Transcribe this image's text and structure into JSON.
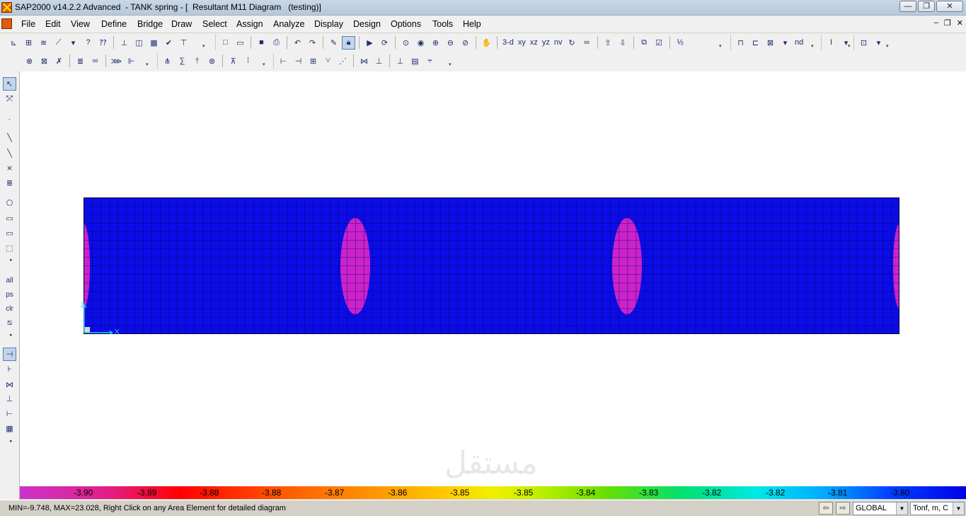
{
  "window": {
    "title": "SAP2000 v14.2.2 Advanced  - TANK spring - [  Resultant M11 Diagram   (testing)]",
    "minimize": "—",
    "maximize": "❐",
    "close": "✕"
  },
  "menu": {
    "items": [
      "File",
      "Edit",
      "View",
      "Define",
      "Bridge",
      "Draw",
      "Select",
      "Assign",
      "Analyze",
      "Display",
      "Design",
      "Options",
      "Tools",
      "Help"
    ],
    "mdi_minimize": "–",
    "mdi_restore": "❐",
    "mdi_close": "✕"
  },
  "toolbar": {
    "view_3d": "3-d",
    "view_xy": "xy",
    "view_xz": "xz",
    "view_yz": "yz",
    "view_nv": "nv",
    "nd": "nd"
  },
  "lefttoolbar": {
    "all": "all",
    "ps": "ps",
    "clr": "clr"
  },
  "model": {
    "colors": {
      "mesh_fill": "#0c0ce8",
      "grid_line": "#000050",
      "contour_spot": "#cc22cc",
      "axis": "#22ccee"
    },
    "axis_x_label": "X",
    "axis_z_label": "Z"
  },
  "legend": {
    "labels": [
      "-3.90",
      "-3.89",
      "-3.88",
      "-3.88",
      "-3.87",
      "-3.86",
      "-3.85",
      "-3.85",
      "-3.84",
      "-3.83",
      "-3.82",
      "-3.82",
      "-3.81",
      "-3.80"
    ]
  },
  "watermark": {
    "arabic": "مستقل",
    "latin": "mostaql.com"
  },
  "status": {
    "text": "MIN=-9.748, MAX=23.028, Right Click on any Area Element for detailed diagram",
    "coord_system": "GLOBAL",
    "units": "Tonf, m, C"
  }
}
